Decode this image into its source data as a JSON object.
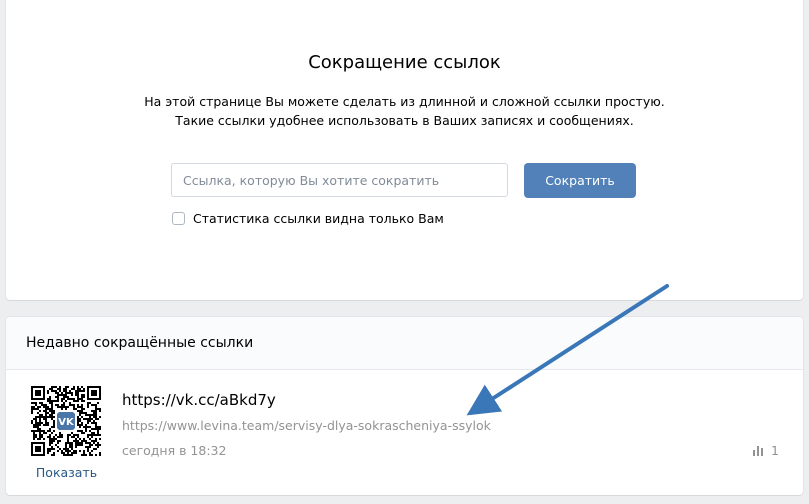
{
  "shorten": {
    "title": "Сокращение ссылок",
    "description_line1": "На этой странице Вы можете сделать из длинной и сложной ссылки простую.",
    "description_line2": "Такие ссылки удобнее использовать в Ваших записях и сообщениях.",
    "input_placeholder": "Ссылка, которую Вы хотите сократить",
    "input_value": "",
    "button_label": "Сократить",
    "checkbox_label": "Статистика ссылки видна только Вам",
    "checkbox_checked": false
  },
  "recent": {
    "title": "Недавно сокращённые ссылки",
    "items": [
      {
        "short_url": "https://vk.cc/aBkd7y",
        "original_url": "https://www.levina.team/servisy-dlya-sokrascheniya-ssylok",
        "time": "сегодня в 18:32",
        "views": "1",
        "show_label": "Показать",
        "qr_icon": "qr-code-icon",
        "views_icon": "bar-chart-icon"
      }
    ]
  },
  "colors": {
    "accent": "#5181b8",
    "link": "#2a5885",
    "muted": "#939393",
    "arrow": "#3a77b8",
    "background": "#edeef0"
  }
}
